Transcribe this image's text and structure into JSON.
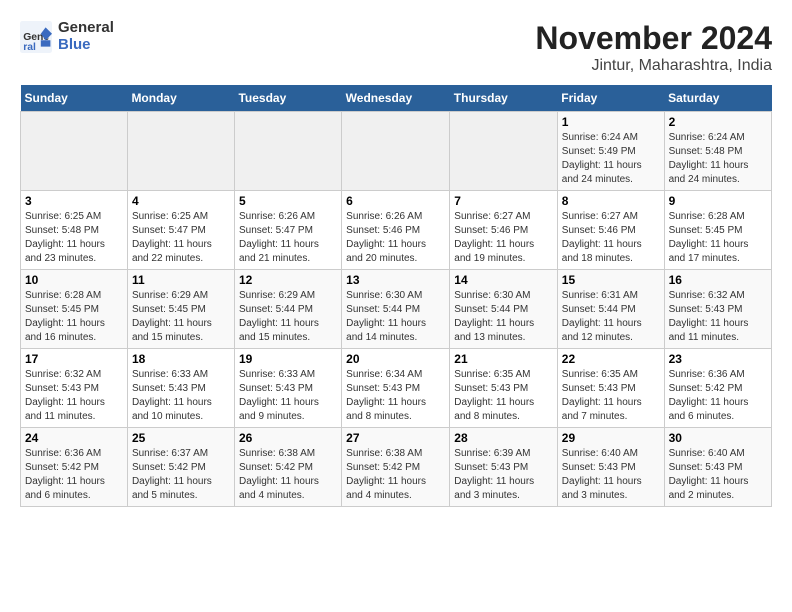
{
  "logo": {
    "general": "General",
    "blue": "Blue"
  },
  "title": "November 2024",
  "subtitle": "Jintur, Maharashtra, India",
  "headers": [
    "Sunday",
    "Monday",
    "Tuesday",
    "Wednesday",
    "Thursday",
    "Friday",
    "Saturday"
  ],
  "weeks": [
    [
      {
        "day": "",
        "empty": true
      },
      {
        "day": "",
        "empty": true
      },
      {
        "day": "",
        "empty": true
      },
      {
        "day": "",
        "empty": true
      },
      {
        "day": "",
        "empty": true
      },
      {
        "day": "1",
        "sunrise": "6:24 AM",
        "sunset": "5:49 PM",
        "daylight": "11 hours and 24 minutes."
      },
      {
        "day": "2",
        "sunrise": "6:24 AM",
        "sunset": "5:48 PM",
        "daylight": "11 hours and 24 minutes."
      }
    ],
    [
      {
        "day": "3",
        "sunrise": "6:25 AM",
        "sunset": "5:48 PM",
        "daylight": "11 hours and 23 minutes."
      },
      {
        "day": "4",
        "sunrise": "6:25 AM",
        "sunset": "5:47 PM",
        "daylight": "11 hours and 22 minutes."
      },
      {
        "day": "5",
        "sunrise": "6:26 AM",
        "sunset": "5:47 PM",
        "daylight": "11 hours and 21 minutes."
      },
      {
        "day": "6",
        "sunrise": "6:26 AM",
        "sunset": "5:46 PM",
        "daylight": "11 hours and 20 minutes."
      },
      {
        "day": "7",
        "sunrise": "6:27 AM",
        "sunset": "5:46 PM",
        "daylight": "11 hours and 19 minutes."
      },
      {
        "day": "8",
        "sunrise": "6:27 AM",
        "sunset": "5:46 PM",
        "daylight": "11 hours and 18 minutes."
      },
      {
        "day": "9",
        "sunrise": "6:28 AM",
        "sunset": "5:45 PM",
        "daylight": "11 hours and 17 minutes."
      }
    ],
    [
      {
        "day": "10",
        "sunrise": "6:28 AM",
        "sunset": "5:45 PM",
        "daylight": "11 hours and 16 minutes."
      },
      {
        "day": "11",
        "sunrise": "6:29 AM",
        "sunset": "5:45 PM",
        "daylight": "11 hours and 15 minutes."
      },
      {
        "day": "12",
        "sunrise": "6:29 AM",
        "sunset": "5:44 PM",
        "daylight": "11 hours and 15 minutes."
      },
      {
        "day": "13",
        "sunrise": "6:30 AM",
        "sunset": "5:44 PM",
        "daylight": "11 hours and 14 minutes."
      },
      {
        "day": "14",
        "sunrise": "6:30 AM",
        "sunset": "5:44 PM",
        "daylight": "11 hours and 13 minutes."
      },
      {
        "day": "15",
        "sunrise": "6:31 AM",
        "sunset": "5:44 PM",
        "daylight": "11 hours and 12 minutes."
      },
      {
        "day": "16",
        "sunrise": "6:32 AM",
        "sunset": "5:43 PM",
        "daylight": "11 hours and 11 minutes."
      }
    ],
    [
      {
        "day": "17",
        "sunrise": "6:32 AM",
        "sunset": "5:43 PM",
        "daylight": "11 hours and 11 minutes."
      },
      {
        "day": "18",
        "sunrise": "6:33 AM",
        "sunset": "5:43 PM",
        "daylight": "11 hours and 10 minutes."
      },
      {
        "day": "19",
        "sunrise": "6:33 AM",
        "sunset": "5:43 PM",
        "daylight": "11 hours and 9 minutes."
      },
      {
        "day": "20",
        "sunrise": "6:34 AM",
        "sunset": "5:43 PM",
        "daylight": "11 hours and 8 minutes."
      },
      {
        "day": "21",
        "sunrise": "6:35 AM",
        "sunset": "5:43 PM",
        "daylight": "11 hours and 8 minutes."
      },
      {
        "day": "22",
        "sunrise": "6:35 AM",
        "sunset": "5:43 PM",
        "daylight": "11 hours and 7 minutes."
      },
      {
        "day": "23",
        "sunrise": "6:36 AM",
        "sunset": "5:42 PM",
        "daylight": "11 hours and 6 minutes."
      }
    ],
    [
      {
        "day": "24",
        "sunrise": "6:36 AM",
        "sunset": "5:42 PM",
        "daylight": "11 hours and 6 minutes."
      },
      {
        "day": "25",
        "sunrise": "6:37 AM",
        "sunset": "5:42 PM",
        "daylight": "11 hours and 5 minutes."
      },
      {
        "day": "26",
        "sunrise": "6:38 AM",
        "sunset": "5:42 PM",
        "daylight": "11 hours and 4 minutes."
      },
      {
        "day": "27",
        "sunrise": "6:38 AM",
        "sunset": "5:42 PM",
        "daylight": "11 hours and 4 minutes."
      },
      {
        "day": "28",
        "sunrise": "6:39 AM",
        "sunset": "5:43 PM",
        "daylight": "11 hours and 3 minutes."
      },
      {
        "day": "29",
        "sunrise": "6:40 AM",
        "sunset": "5:43 PM",
        "daylight": "11 hours and 3 minutes."
      },
      {
        "day": "30",
        "sunrise": "6:40 AM",
        "sunset": "5:43 PM",
        "daylight": "11 hours and 2 minutes."
      }
    ]
  ],
  "labels": {
    "sunrise": "Sunrise:",
    "sunset": "Sunset:",
    "daylight": "Daylight:"
  }
}
